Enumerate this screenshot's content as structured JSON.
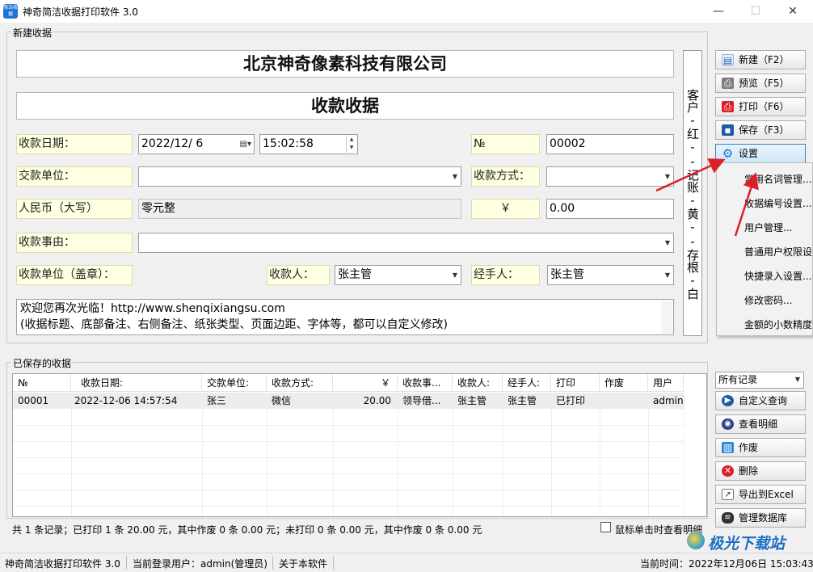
{
  "window": {
    "title": "神奇简洁收据打印软件 3.0",
    "icon_text": "简洁收据",
    "minimize": "—",
    "maximize": "☐",
    "close": "✕"
  },
  "new_receipt": {
    "group_title": "新建收据",
    "company": "北京神奇像素科技有限公司",
    "doc_title": "收款收据",
    "date_label": "收款日期：",
    "date_value": "2022/12/  6",
    "time_value": "15:02:58",
    "no_label": "№",
    "no_value": "00002",
    "payer_label": "交款单位：",
    "payer_value": "",
    "method_label": "收款方式：",
    "method_value": "",
    "rmb_label": "人民币（大写）",
    "rmb_value": "零元整",
    "yen_label": "￥",
    "amount_value": "0.00",
    "reason_label": "收款事由：",
    "reason_value": "",
    "stamp_label": "收款单位（盖章）：",
    "receiver_label": "收款人：",
    "receiver_value": "张主管",
    "handler_label": "经手人：",
    "handler_value": "张主管",
    "note_line1": "欢迎您再次光临！http://www.shenqixiangsu.com",
    "note_line2": "(收据标题、底部备注、右侧备注、纸张类型、页面边距、字体等，都可以自定义修改)",
    "side_note": "客户-红--记账-黄--存根-白"
  },
  "buttons": {
    "new": "新建（F2）",
    "preview": "预览（F5）",
    "print": "打印（F6）",
    "save": "保存（F3）",
    "settings": "设置",
    "custom_query": "自定义查询",
    "view_detail": "查看明细",
    "void": "作废",
    "delete": "删除",
    "export_excel": "导出到Excel",
    "manage_db": "管理数据库"
  },
  "settings_menu": [
    "常用名词管理...",
    "收据编号设置...",
    "用户管理...",
    "普通用户权限设置...",
    "快捷录入设置...",
    "修改密码...",
    "金额的小数精度"
  ],
  "saved": {
    "group_title": "已保存的收据",
    "filter_value": "所有记录",
    "columns": [
      "№",
      "收款日期:",
      "交款单位:",
      "收款方式:",
      "￥",
      "收款事...",
      "收款人:",
      "经手人:",
      "打印",
      "作废",
      "用户"
    ],
    "rows": [
      [
        "00001",
        "2022-12-06 14:57:54",
        "张三",
        "微信",
        "20.00",
        "领导借...",
        "张主管",
        "张主管",
        "已打印",
        "",
        "admin"
      ]
    ],
    "summary": "共 1 条记录；已打印 1 条 20.00 元，其中作废 0 条 0.00 元；未打印 0 条 0.00 元，其中作废 0 条 0.00 元",
    "click_detail_label": "鼠标单击时查看明细"
  },
  "status": {
    "app": "神奇简洁收据打印软件 3.0",
    "user": "当前登录用户：admin(管理员)",
    "about": "关于本软件",
    "time": "当前时间：2022年12月06日 15:03:43"
  },
  "watermark": {
    "text": "极光下载站"
  },
  "colors": {
    "accent_red": "#d9202a",
    "label_bg": "#ffffe1"
  }
}
